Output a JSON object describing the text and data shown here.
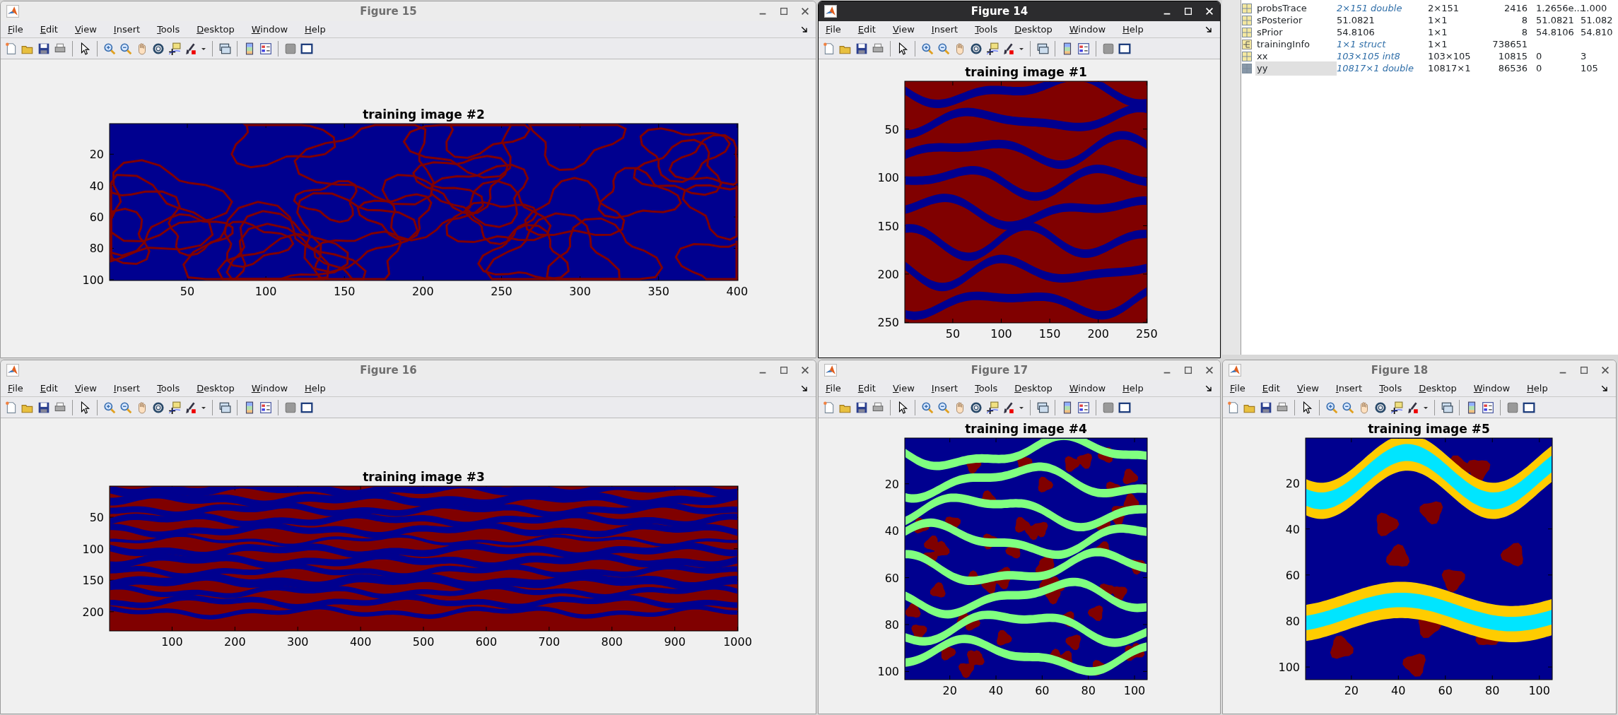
{
  "figures": [
    {
      "title": "Figure 15",
      "active": false,
      "menu": [
        "File",
        "Edit",
        "View",
        "Insert",
        "Tools",
        "Desktop",
        "Window",
        "Help"
      ],
      "plot": {
        "kind": "loops",
        "title": "training image #2",
        "y_ticks": [
          "20",
          "40",
          "60",
          "80",
          "100"
        ],
        "x_ticks": [
          "50",
          "100",
          "150",
          "200",
          "250",
          "300",
          "350",
          "400"
        ]
      }
    },
    {
      "title": "Figure 14",
      "active": true,
      "menu": [
        "File",
        "Edit",
        "View",
        "Insert",
        "Tools",
        "Desktop",
        "Window",
        "Help"
      ],
      "plot": {
        "kind": "channels",
        "title": "training image #1",
        "y_ticks": [
          "50",
          "100",
          "150",
          "200",
          "250"
        ],
        "x_ticks": [
          "50",
          "100",
          "150",
          "200",
          "250"
        ]
      }
    },
    {
      "title": "Figure 16",
      "active": false,
      "menu": [
        "File",
        "Edit",
        "View",
        "Insert",
        "Tools",
        "Desktop",
        "Window",
        "Help"
      ],
      "plot": {
        "kind": "layers",
        "title": "training image #3",
        "y_ticks": [
          "50",
          "100",
          "150",
          "200"
        ],
        "x_ticks": [
          "100",
          "200",
          "300",
          "400",
          "500",
          "600",
          "700",
          "800",
          "900",
          "1000"
        ]
      }
    },
    {
      "title": "Figure 17",
      "active": false,
      "menu": [
        "File",
        "Edit",
        "View",
        "Insert",
        "Tools",
        "Desktop",
        "Window",
        "Help"
      ],
      "plot": {
        "kind": "bodies",
        "title": "training image #4",
        "y_ticks": [
          "20",
          "40",
          "60",
          "80",
          "100"
        ],
        "x_ticks": [
          "20",
          "40",
          "60",
          "80",
          "100"
        ]
      }
    },
    {
      "title": "Figure 18",
      "active": false,
      "menu": [
        "File",
        "Edit",
        "View",
        "Insert",
        "Tools",
        "Desktop",
        "Window",
        "Help"
      ],
      "plot": {
        "kind": "waves",
        "title": "training image #5",
        "y_ticks": [
          "20",
          "40",
          "60",
          "80",
          "100"
        ],
        "x_ticks": [
          "20",
          "40",
          "60",
          "80",
          "100"
        ]
      }
    }
  ],
  "workspace": {
    "rows": [
      {
        "kind": "matrix",
        "name": "probsTrace",
        "value": "2×151 double",
        "size": "2×151",
        "bytes": "2416",
        "min": "1.2656e...",
        "max": "1.000",
        "selected": false
      },
      {
        "kind": "scalar",
        "name": "sPosterior",
        "value": "51.0821",
        "size": "1×1",
        "bytes": "8",
        "min": "51.0821",
        "max": "51.082",
        "selected": false
      },
      {
        "kind": "scalar",
        "name": "sPrior",
        "value": "54.8106",
        "size": "1×1",
        "bytes": "8",
        "min": "54.8106",
        "max": "54.810",
        "selected": false
      },
      {
        "kind": "struct",
        "name": "trainingInfo",
        "value": "1×1 struct",
        "size": "1×1",
        "bytes": "738651",
        "selected": false
      },
      {
        "kind": "matrix",
        "name": "xx",
        "value": "103×105 int8",
        "size": "103×105",
        "bytes": "10815",
        "min": "0",
        "max": "3",
        "selected": false
      },
      {
        "kind": "matrix",
        "name": "yy",
        "value": "10817×1 double",
        "size": "10817×1",
        "bytes": "86536",
        "min": "0",
        "max": "105",
        "selected": true
      }
    ]
  }
}
